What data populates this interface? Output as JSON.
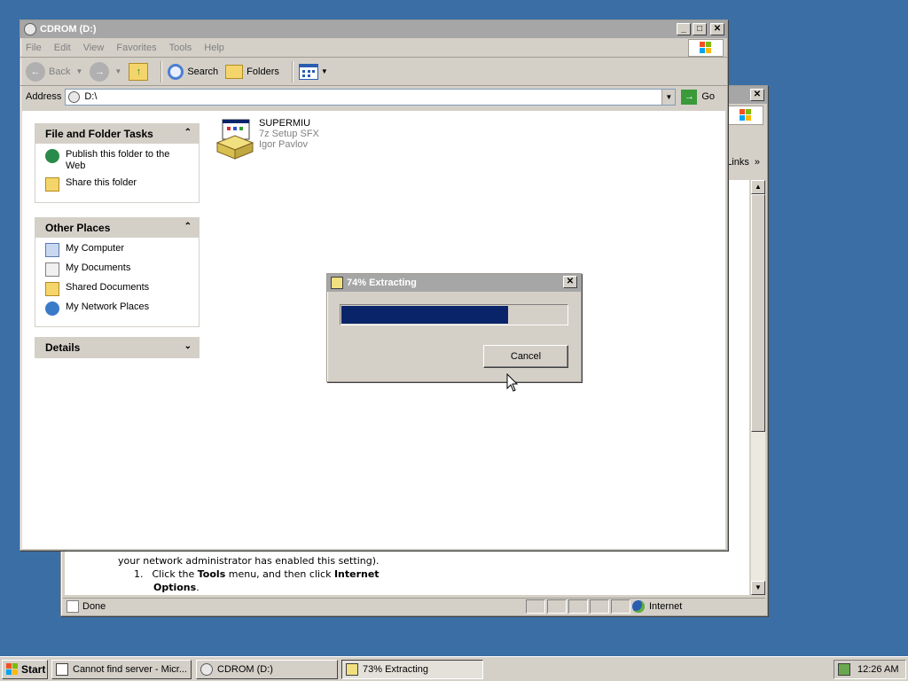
{
  "explorer": {
    "title": "CDROM (D:)",
    "menu": [
      "File",
      "Edit",
      "View",
      "Favorites",
      "Tools",
      "Help"
    ],
    "toolbar": {
      "back": "Back",
      "search": "Search",
      "folders": "Folders"
    },
    "address": {
      "label": "Address",
      "value": "D:\\",
      "go": "Go"
    },
    "file_tasks": {
      "title": "File and Folder Tasks",
      "items": [
        "Publish this folder to the Web",
        "Share this folder"
      ]
    },
    "other_places": {
      "title": "Other Places",
      "items": [
        "My Computer",
        "My Documents",
        "Shared Documents",
        "My Network Places"
      ]
    },
    "details": {
      "title": "Details"
    },
    "file": {
      "name": "SUPERMIU",
      "type": "7z Setup SFX",
      "author": "Igor Pavlov"
    }
  },
  "ie": {
    "links": "Links",
    "content_line1": "your network administrator has enabled this setting).",
    "step_num": "1.",
    "step_text_a": "Click the ",
    "step_text_b": "Tools",
    "step_text_c": " menu, and then click ",
    "step_text_d": "Internet",
    "step_text_e": "Options",
    "step_text_f": ".",
    "status": "Done",
    "zone": "Internet"
  },
  "dialog": {
    "title": "74% Extracting",
    "progress": 0.74,
    "cancel": "Cancel"
  },
  "taskbar": {
    "start": "Start",
    "tasks": [
      "Cannot find server - Micr...",
      "CDROM (D:)",
      "73% Extracting"
    ],
    "clock": "12:26 AM"
  },
  "colors": {
    "desktop": "#3a6ea5",
    "progress": "#0a246a",
    "active_title": "#0a246a"
  }
}
